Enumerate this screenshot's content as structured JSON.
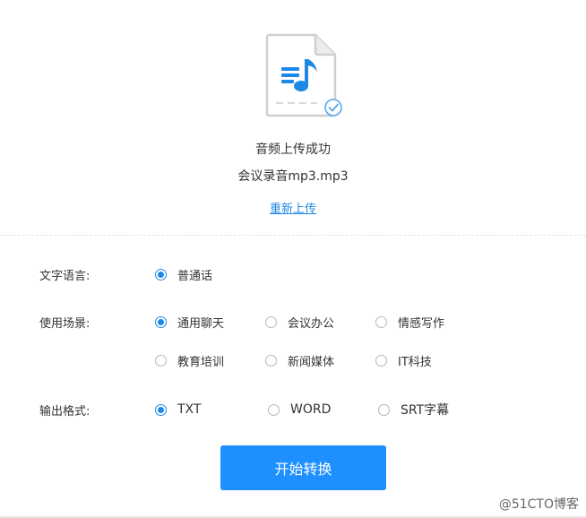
{
  "upload": {
    "status": "音频上传成功",
    "filename": "会议录音mp3.mp3",
    "reupload_label": "重新上传"
  },
  "language": {
    "label": "文字语言:",
    "options": [
      {
        "label": "普通话",
        "checked": true
      }
    ]
  },
  "scene": {
    "label": "使用场景:",
    "options": [
      {
        "label": "通用聊天",
        "checked": true
      },
      {
        "label": "会议办公",
        "checked": false
      },
      {
        "label": "情感写作",
        "checked": false
      },
      {
        "label": "教育培训",
        "checked": false
      },
      {
        "label": "新闻媒体",
        "checked": false
      },
      {
        "label": "IT科技",
        "checked": false
      }
    ]
  },
  "format": {
    "label": "输出格式:",
    "options": [
      {
        "label": "TXT",
        "checked": true
      },
      {
        "label": "WORD",
        "checked": false
      },
      {
        "label": "SRT字幕",
        "checked": false
      }
    ]
  },
  "actions": {
    "start_label": "开始转换"
  },
  "watermark": "@51CTO博客",
  "colors": {
    "accent": "#1e88e5",
    "button": "#1e8fff",
    "text": "#333333",
    "icon_gray": "#d0d0d0"
  },
  "icons": {
    "file": "audio-file-icon",
    "music": "music-note-icon",
    "check": "check-circle-icon"
  }
}
